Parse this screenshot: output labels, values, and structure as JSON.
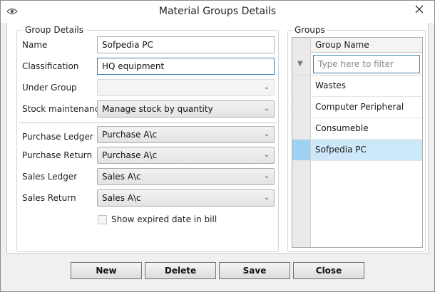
{
  "window": {
    "title": "Material Groups Details",
    "close_glyph": "✕",
    "app_icon": "eye-icon"
  },
  "group_details": {
    "legend": "Group Details",
    "name": {
      "label": "Name",
      "value": "Sofpedia PC"
    },
    "classification": {
      "label": "Classification",
      "value": "HQ equipment"
    },
    "under_group": {
      "label": "Under Group",
      "value": ""
    },
    "stock_maintenance": {
      "label": "Stock maintenance",
      "value": "Manage stock by quantity"
    },
    "purchase_ledger": {
      "label": "Purchase Ledger",
      "value": "Purchase A\\c"
    },
    "purchase_return": {
      "label": "Purchase Return",
      "value": "Purchase A\\c"
    },
    "sales_ledger": {
      "label": "Sales Ledger",
      "value": "Sales A\\c"
    },
    "sales_return": {
      "label": "Sales Return",
      "value": "Sales A\\c"
    },
    "show_expired": {
      "label": "Show expired date in bill",
      "checked": false
    }
  },
  "groups": {
    "legend": "Groups",
    "column_header": "Group Name",
    "filter_placeholder": "Type here to filter",
    "rows": [
      {
        "name": "Wastes"
      },
      {
        "name": "Computer Peripheral"
      },
      {
        "name": "Consumeble"
      },
      {
        "name": "Sofpedia PC",
        "selected": true
      }
    ]
  },
  "buttons": {
    "new": "New",
    "delete": "Delete",
    "save": "Save",
    "close": "Close"
  },
  "colors": {
    "selected_row": "#cde8f8",
    "focus_border": "#3c7fb1"
  }
}
